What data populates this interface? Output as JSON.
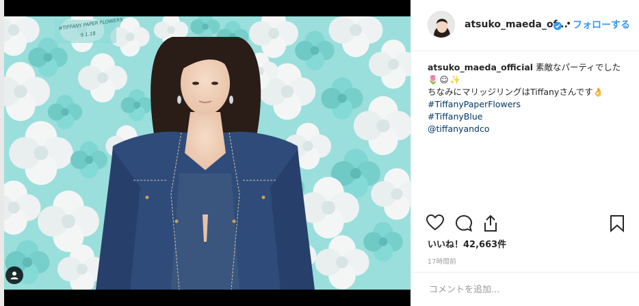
{
  "header": {
    "username": "atsuko_maeda_of...",
    "separator": "•",
    "follow_label": "フォローする"
  },
  "photo": {
    "handwritten_text": "#TIFFANY PAPER FLOWERS 9.1.18"
  },
  "caption": {
    "username": "atsuko_maeda_official",
    "text": " 素敵なパーティでした",
    "emojis": "🌷☺✨",
    "line2": "ちなみにマリッジリングはTiffanyさんです👌",
    "hashtags": [
      "#TiffanyPaperFlowers",
      "#TiffanyBlue",
      "@tiffanyandco"
    ]
  },
  "likes": "いいね！42,663件",
  "timestamp": "17時間前",
  "comment": {
    "placeholder": "コメントを追加..."
  },
  "colors": {
    "accent": "#3897f0",
    "tiffany_blue": "#81d8d0",
    "hashtag": "#003569"
  }
}
